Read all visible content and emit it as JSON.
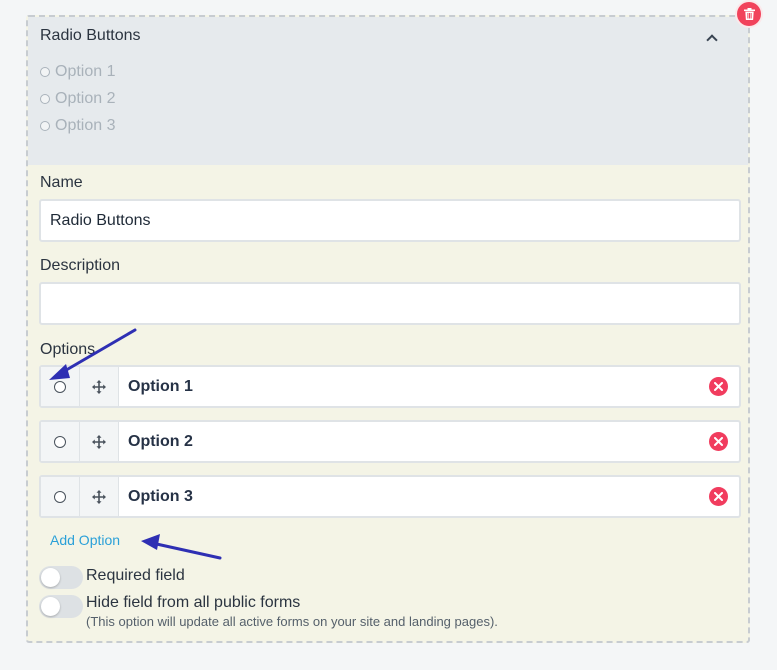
{
  "preview": {
    "title": "Radio Buttons",
    "options": [
      "Option 1",
      "Option 2",
      "Option 3"
    ]
  },
  "editor": {
    "name_label": "Name",
    "name_value": "Radio Buttons",
    "description_label": "Description",
    "description_value": "",
    "options_label": "Options",
    "options": [
      "Option 1",
      "Option 2",
      "Option 3"
    ],
    "add_option_label": "Add Option"
  },
  "toggles": {
    "required_label": "Required field",
    "hide_label": "Hide field from all public forms",
    "hide_note": "(This option will update all active forms on your site and landing pages)."
  },
  "icons": {
    "delete": "trash-icon",
    "collapse": "chevron-up-icon",
    "drag": "move-icon",
    "remove": "close-circle-icon"
  },
  "colors": {
    "accent_link": "#2aa0d8",
    "danger": "#f13c5e",
    "preview_bg": "#e6eaed",
    "editor_bg": "#f4f4e6",
    "annotation_arrow": "#2e2fb3"
  }
}
